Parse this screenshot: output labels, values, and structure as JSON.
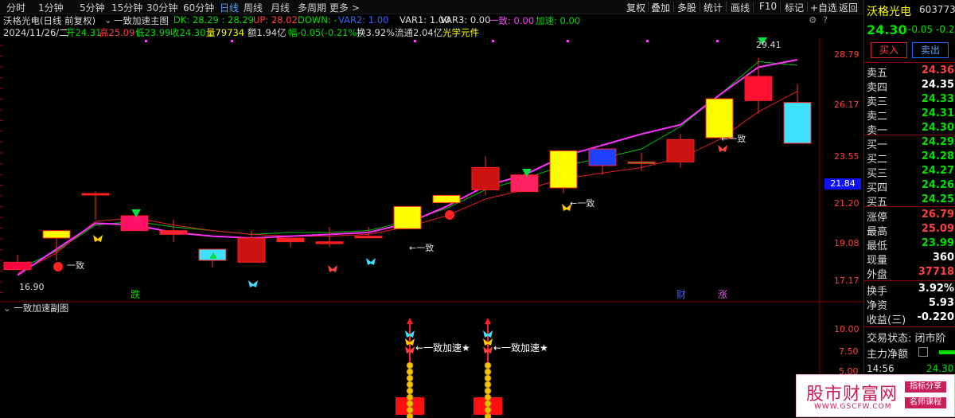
{
  "tabs": [
    "分时",
    "1分钟",
    "5分钟",
    "15分钟",
    "30分钟",
    "60分钟",
    "日线",
    "周线",
    "月线",
    "多周期",
    "更多 >"
  ],
  "active_tab": "日线",
  "toolbar": [
    "复权",
    "叠加",
    "多股",
    "统计",
    "画线",
    "F10",
    "标记",
    "+自选",
    "返回"
  ],
  "info": {
    "title": "沃格光电(日线 前复权)",
    "indicator": "一致加速主图",
    "dk": "DK: 28.29 : 28.29",
    "up": "UP: 28.02",
    "down": "DOWN: -",
    "var2": "VAR2: 1.00",
    "var1": "VAR1: 1.00",
    "var3": "VAR3: 0.00",
    "yizhi": "一致: 0.00",
    "jiasu": "加速: 0.00",
    "date": "2024/11/26/二",
    "open": "开24.31",
    "high": "高25.09",
    "low": "低23.99",
    "close": "收24.30",
    "vol": "量79734",
    "amount": "额1.94亿",
    "change": "幅-0.05(-0.21%)",
    "turnover": "换3.92%",
    "float": "流通2.04亿",
    "concept": "光学元件"
  },
  "sub_title": "一致加速副图",
  "y_ticks": [
    "28.79",
    "26.17",
    "23.55",
    "21.20",
    "19.08",
    "17.17"
  ],
  "sub_ticks": [
    "10.00",
    "7.50",
    "5.00"
  ],
  "price_marker": "21.84",
  "annotations": {
    "high_label": "29.41",
    "low_label": "16.90",
    "yizhi": "一致",
    "arrow_yizhi": "←一致",
    "jiasu": "←一致加速★",
    "die": "跌",
    "cai": "财",
    "zhang": "涨"
  },
  "chart_data": {
    "type": "candlestick",
    "candles": [
      {
        "o": 17.9,
        "h": 18.3,
        "l": 17.5,
        "c": 17.5
      },
      {
        "o": 19.2,
        "h": 19.6,
        "l": 18.0,
        "c": 19.6
      },
      {
        "o": 21.6,
        "h": 21.7,
        "l": 20.2,
        "c": 21.6
      },
      {
        "o": 20.4,
        "h": 20.4,
        "l": 19.6,
        "c": 19.6
      },
      {
        "o": 19.6,
        "h": 20.2,
        "l": 19.0,
        "c": 19.4
      },
      {
        "o": 18.0,
        "h": 18.6,
        "l": 17.6,
        "c": 18.6
      },
      {
        "o": 19.2,
        "h": 19.6,
        "l": 17.9,
        "c": 17.9
      },
      {
        "o": 19.0,
        "h": 19.2,
        "l": 18.7,
        "c": 19.2
      },
      {
        "o": 18.9,
        "h": 19.8,
        "l": 18.7,
        "c": 19.0
      },
      {
        "o": 19.3,
        "h": 19.8,
        "l": 19.3,
        "c": 19.3
      },
      {
        "o": 20.9,
        "h": 20.9,
        "l": 19.7,
        "c": 19.7
      },
      {
        "o": 21.5,
        "h": 21.5,
        "l": 21.1,
        "c": 21.1
      },
      {
        "o": 23.0,
        "h": 23.6,
        "l": 21.5,
        "c": 21.8
      },
      {
        "o": 22.6,
        "h": 22.7,
        "l": 21.7,
        "c": 21.7
      },
      {
        "o": 23.9,
        "h": 23.9,
        "l": 21.6,
        "c": 21.9
      },
      {
        "o": 24.0,
        "h": 24.0,
        "l": 22.6,
        "c": 23.1
      },
      {
        "o": 23.3,
        "h": 23.8,
        "l": 22.8,
        "c": 23.3
      },
      {
        "o": 23.3,
        "h": 24.8,
        "l": 23.0,
        "c": 24.5
      },
      {
        "o": 26.7,
        "h": 26.7,
        "l": 24.6,
        "c": 24.6
      },
      {
        "o": 27.9,
        "h": 28.9,
        "l": 25.9,
        "c": 26.6
      },
      {
        "o": 26.5,
        "h": 27.5,
        "l": 24.3,
        "c": 24.3
      }
    ],
    "ma_purple": [
      17.2,
      18.6,
      20.0,
      19.9,
      19.5,
      19.3,
      19.2,
      19.3,
      19.4,
      19.5,
      20.0,
      20.9,
      22.0,
      22.6,
      23.6,
      24.2,
      24.8,
      25.3,
      26.9,
      28.4,
      28.8
    ],
    "ma_green": [
      17.5,
      18.5,
      19.9,
      20.1,
      19.8,
      19.6,
      19.4,
      19.5,
      19.5,
      19.6,
      20.1,
      20.8,
      21.8,
      22.4,
      23.1,
      23.5,
      24.0,
      25.2,
      26.9,
      28.7,
      28.5
    ],
    "ma_red": [
      17.3,
      18.4,
      20.1,
      20.3,
      19.9,
      19.6,
      19.4,
      19.3,
      19.3,
      19.4,
      19.8,
      20.4,
      21.3,
      21.8,
      22.4,
      22.7,
      23.0,
      23.5,
      24.5,
      26.0,
      27.1
    ],
    "ylim": [
      16.5,
      30.0
    ]
  },
  "right": {
    "name": "沃格光电",
    "code": "603773",
    "price": "24.30",
    "change": "-0.05",
    "pct": "-0.2",
    "buy": "买入",
    "sell": "卖出",
    "asks": [
      [
        "卖五",
        "24.36"
      ],
      [
        "卖四",
        "24.35"
      ],
      [
        "卖三",
        "24.33"
      ],
      [
        "卖二",
        "24.31"
      ],
      [
        "卖一",
        "24.30"
      ]
    ],
    "bids": [
      [
        "买一",
        "24.29"
      ],
      [
        "买二",
        "24.28"
      ],
      [
        "买三",
        "24.27"
      ],
      [
        "买四",
        "24.26"
      ],
      [
        "买五",
        "24.25"
      ]
    ],
    "stats": [
      [
        "涨停",
        "26.79"
      ],
      [
        "最高",
        "25.09"
      ],
      [
        "最低",
        "23.99"
      ],
      [
        "现量",
        "360"
      ],
      [
        "外盘",
        "37718"
      ]
    ],
    "stats2": [
      [
        "换手",
        "3.92%"
      ],
      [
        "净资",
        "5.93"
      ],
      [
        "收益(三)",
        "-0.220"
      ]
    ],
    "trade_status": "交易状态: 闭市阶",
    "main_net": "主力净额",
    "time": "14:56",
    "time_price": "24.30"
  },
  "watermark": {
    "title": "股市财富网",
    "url": "WWW.GSCFW.COM",
    "tag1": "指标分享",
    "tag2": "名师课程"
  }
}
